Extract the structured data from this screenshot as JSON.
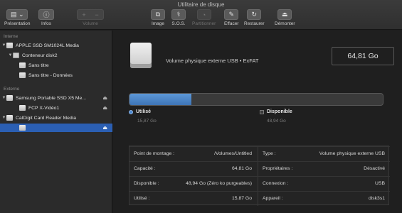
{
  "window": {
    "title": "Utilitaire de disque"
  },
  "toolbar": {
    "presentation": "Présentation",
    "infos": "Infos",
    "volume": "Volume",
    "image": "Image",
    "sos": "S.O.S.",
    "partition": "Partitionner",
    "erase": "Effacer",
    "restore": "Restaurer",
    "unmount": "Démonter",
    "add_symbol": "+",
    "remove_symbol": "−"
  },
  "sidebar": {
    "internal_label": "Interne",
    "external_label": "Externe",
    "items": [
      {
        "label": "APPLE SSD SM1024L Media"
      },
      {
        "label": "Conteneur disk2"
      },
      {
        "label": "Sans titre"
      },
      {
        "label": "Sans titre - Données"
      },
      {
        "label": "Samsung Portable SSD X5 Me..."
      },
      {
        "label": "FCP X-Vidéo1"
      },
      {
        "label": "CalDigit Card Reader Media"
      },
      {
        "label": ""
      }
    ]
  },
  "volume": {
    "description": "Volume physique externe USB • ExFAT",
    "capacity": "64,81 Go",
    "used_fraction": 0.245,
    "used_label": "Utilisé",
    "used_value": "15,87 Go",
    "free_label": "Disponible",
    "free_value": "48,94 Go"
  },
  "info": {
    "left": [
      {
        "key": "Point de montage :",
        "value": "/Volumes/Untitled"
      },
      {
        "key": "Capacité :",
        "value": "64,81 Go"
      },
      {
        "key": "Disponible :",
        "value": "48,94 Go (Zéro ko purgeables)"
      },
      {
        "key": "Utilisé :",
        "value": "15,87 Go"
      }
    ],
    "right": [
      {
        "key": "Type :",
        "value": "Volume physique externe USB"
      },
      {
        "key": "Propriétaires :",
        "value": "Désactivé"
      },
      {
        "key": "Connexion :",
        "value": "USB"
      },
      {
        "key": "Appareil :",
        "value": "disk3s1"
      }
    ]
  },
  "colors": {
    "accent": "#2b5fb3",
    "used_bar": "#4b88cf"
  }
}
